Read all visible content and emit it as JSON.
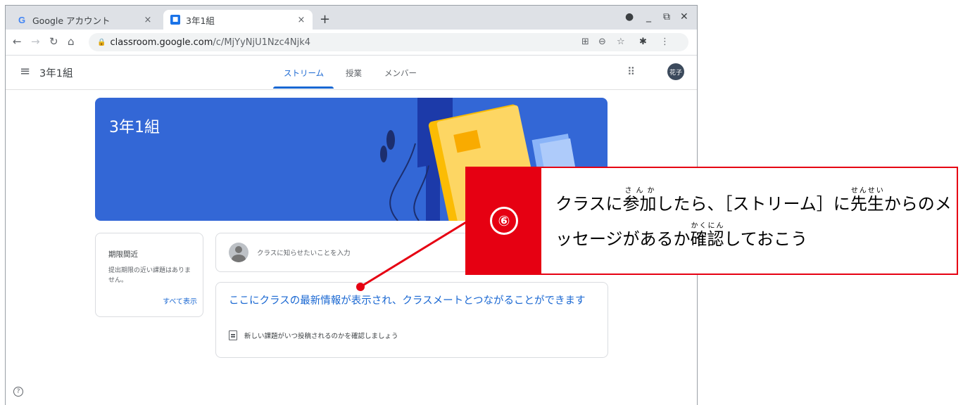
{
  "browser": {
    "tabs": [
      {
        "title": "Google アカウント",
        "close": "×"
      },
      {
        "title": "3年1組",
        "close": "×"
      }
    ],
    "new_tab": "+",
    "url_host": "classroom.google.com",
    "url_path": "/c/MjYyNjU1Nzc4Njk4"
  },
  "classroom": {
    "class_name": "3年1組",
    "nav_tabs": [
      "ストリーム",
      "授業",
      "メンバー"
    ],
    "user_avatar": "花子",
    "banner_title": "3年1組",
    "upcoming": {
      "title": "期限間近",
      "text": "提出期限の近い課題はありません。",
      "link": "すべて表示"
    },
    "announce_placeholder": "クラスに知らせたいことを入力",
    "info": {
      "headline": "ここにクラスの最新情報が表示され、クラスメートとつながることができます",
      "sub": "新しい課題がいつ投稿されるのかを確認しましょう"
    }
  },
  "callout": {
    "step": "⑥",
    "text_a": "クラスに",
    "sanka": "参加",
    "sanka_ruby": "さんか",
    "text_b": "したら、［ストリーム］に",
    "sensei": "先生",
    "sensei_ruby": "せんせい",
    "text_c": "からのメッセージがあるか",
    "kakunin": "確認",
    "kakunin_ruby": "かくにん",
    "text_d": "しておこう"
  },
  "colors": {
    "accent": "#1967d2",
    "banner": "#3367d6",
    "callout_red": "#e60012"
  }
}
